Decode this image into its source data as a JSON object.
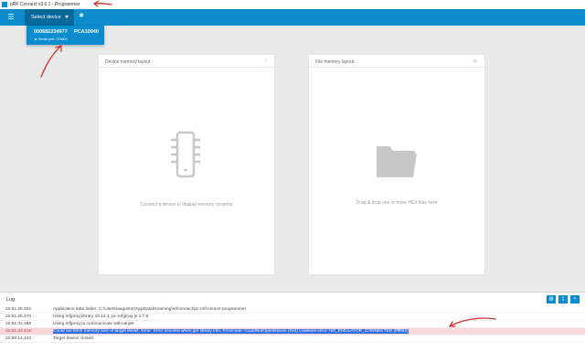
{
  "window": {
    "title": "nRF Connect v3.6.1 - Programmer"
  },
  "topbar": {
    "menu_icon": "hamburger-icon",
    "device_select_label": "Select device",
    "settings_icon": "gear-icon"
  },
  "device_dropdown": {
    "serial": "000682234977",
    "board": "PCA10040",
    "port": "Serial port: COM11"
  },
  "device_memory": {
    "title": "Device memory layout",
    "message": "Connect a device to display memory contents",
    "icon": "chip-icon"
  },
  "file_memory": {
    "title": "File memory layout",
    "message": "Drag & drop one or more HEX files here",
    "icon": "folder-icon"
  },
  "log": {
    "title": "Log",
    "buttons": [
      "folder-icon",
      "clear-icon",
      "plus-icon"
    ],
    "entries": [
      {
        "time": "22:51:25.332",
        "message": "Application data folder: C:\\Users\\augustor\\AppData\\Roaming\\nrfconnect\\pc-nrfconnect-programmer"
      },
      {
        "time": "22:51:25.470",
        "message": "Using nrfjprog library 10.12.1, pc-nrfjprog-js 1.7.6"
      },
      {
        "time": "22:51:32.488",
        "message": "Using nrfjprog to communicate with target"
      },
      {
        "time": "22:51:32.618",
        "message": "Could not fetch memory size of target devkit: Error: Error occured when get library info. Errorcode: CouldNotOpenDevice (0x4) Lowlevel error: NO_EMULATOR_CONNECTED (ffffff82)"
      },
      {
        "time": "22:59:14.143",
        "message": "Target device closed."
      }
    ]
  },
  "colors": {
    "accent": "#0b8dcd",
    "error_row": "#f7d7d9",
    "annotation": "#d0312d"
  }
}
